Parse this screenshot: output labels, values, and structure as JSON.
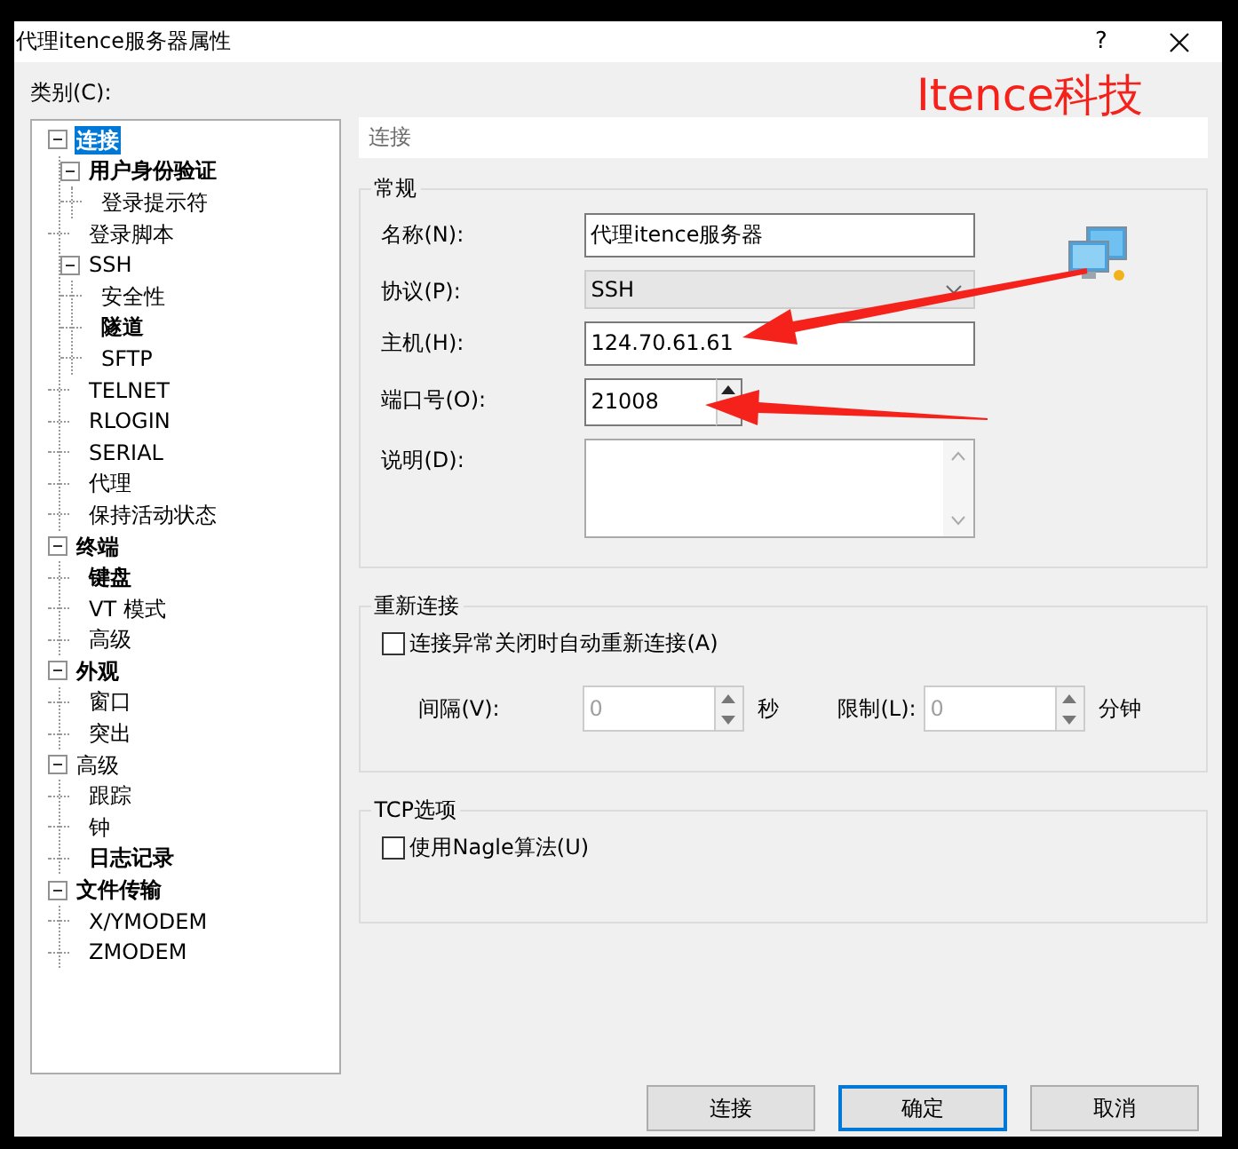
{
  "window": {
    "title": "代理itence服务器属性",
    "help_button": "?"
  },
  "category_label": "类别(C):",
  "tree": [
    {
      "label": "连接",
      "selected": true,
      "modified": true,
      "expanded": true,
      "children": [
        {
          "label": "用户身份验证",
          "selected": false,
          "modified": true,
          "expanded": true,
          "children": [
            {
              "label": "登录提示符",
              "selected": false,
              "modified": false
            }
          ]
        },
        {
          "label": "登录脚本",
          "selected": false,
          "modified": false
        },
        {
          "label": "SSH",
          "selected": false,
          "modified": false,
          "expanded": true,
          "children": [
            {
              "label": "安全性",
              "selected": false,
              "modified": false
            },
            {
              "label": "隧道",
              "selected": false,
              "modified": true
            },
            {
              "label": "SFTP",
              "selected": false,
              "modified": false
            }
          ]
        },
        {
          "label": "TELNET",
          "selected": false,
          "modified": false
        },
        {
          "label": "RLOGIN",
          "selected": false,
          "modified": false
        },
        {
          "label": "SERIAL",
          "selected": false,
          "modified": false
        },
        {
          "label": "代理",
          "selected": false,
          "modified": false
        },
        {
          "label": "保持活动状态",
          "selected": false,
          "modified": false
        }
      ]
    },
    {
      "label": "终端",
      "selected": false,
      "modified": true,
      "expanded": true,
      "children": [
        {
          "label": "键盘",
          "selected": false,
          "modified": true
        },
        {
          "label": "VT 模式",
          "selected": false,
          "modified": false
        },
        {
          "label": "高级",
          "selected": false,
          "modified": false
        }
      ]
    },
    {
      "label": "外观",
      "selected": false,
      "modified": true,
      "expanded": true,
      "children": [
        {
          "label": "窗口",
          "selected": false,
          "modified": false
        },
        {
          "label": "突出",
          "selected": false,
          "modified": false
        }
      ]
    },
    {
      "label": "高级",
      "selected": false,
      "modified": false,
      "expanded": true,
      "children": [
        {
          "label": "跟踪",
          "selected": false,
          "modified": false
        },
        {
          "label": "钟",
          "selected": false,
          "modified": false
        },
        {
          "label": "日志记录",
          "selected": false,
          "modified": true
        }
      ]
    },
    {
      "label": "文件传输",
      "selected": false,
      "modified": true,
      "expanded": true,
      "children": [
        {
          "label": "X/YMODEM",
          "selected": false,
          "modified": false
        },
        {
          "label": "ZMODEM",
          "selected": false,
          "modified": false
        }
      ]
    }
  ],
  "page_header": "连接",
  "general": {
    "title": "常规",
    "fields": [
      {
        "kind": "text",
        "label": "名称(N):",
        "value": "代理itence服务器"
      },
      {
        "kind": "select",
        "label": "协议(P):",
        "value": "SSH"
      },
      {
        "kind": "text",
        "label": "主机(H):",
        "value": "124.70.61.61"
      },
      {
        "kind": "spin",
        "label": "端口号(O):",
        "value": "21008"
      },
      {
        "kind": "textarea",
        "label": "说明(D):"
      }
    ]
  },
  "reconnect": {
    "title": "重新连接",
    "checkbox": {
      "label": "连接异常关闭时自动重新连接(A)",
      "checked": false
    },
    "spins": [
      {
        "label": "间隔(V):",
        "value": "0",
        "unit": "秒",
        "disabled": true
      },
      {
        "label": "限制(L):",
        "value": "0",
        "unit": "分钟",
        "disabled": true
      }
    ]
  },
  "tcp": {
    "title": "TCP选项",
    "checkbox": {
      "label": "使用Nagle算法(U)",
      "checked": false
    }
  },
  "buttons": [
    {
      "label": "连接",
      "focused": false
    },
    {
      "label": "确定",
      "focused": true
    },
    {
      "label": "取消",
      "focused": false
    }
  ],
  "annotation_label": "Itence科技"
}
